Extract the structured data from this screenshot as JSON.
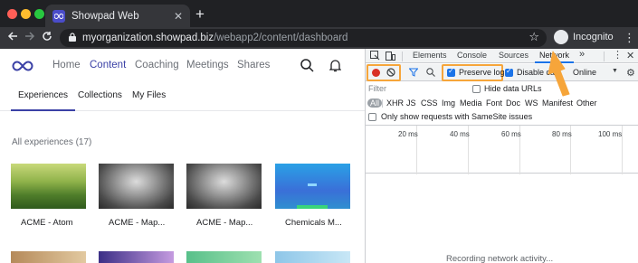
{
  "browser": {
    "tab_title": "Showpad Web",
    "tab_close": "✕",
    "new_tab": "+",
    "url_host": "myorganization.showpad.biz",
    "url_path": "/webapp2/content/dashboard",
    "incognito_label": "Incognito",
    "back_icon": "arrow-left-icon",
    "forward_icon": "arrow-right-icon",
    "reload_icon": "reload-icon"
  },
  "app": {
    "nav": [
      "Home",
      "Content",
      "Coaching",
      "Meetings",
      "Shares"
    ],
    "active_nav": "Content",
    "subtabs": [
      "Experiences",
      "Collections",
      "My Files"
    ],
    "active_subtab": "Experiences",
    "section_title": "All experiences (17)",
    "cards": [
      {
        "label": "ACME - Atom"
      },
      {
        "label": "ACME - Map..."
      },
      {
        "label": "ACME - Map..."
      },
      {
        "label": "Chemicals M..."
      }
    ],
    "accent_color": "#3b41a6"
  },
  "devtools": {
    "tabs": [
      "Elements",
      "Console",
      "Sources",
      "Network"
    ],
    "active_tab": "Network",
    "more": "»",
    "close": "✕",
    "preserve_log": {
      "label": "Preserve log",
      "checked": true
    },
    "disable_cache": {
      "label": "Disable cac",
      "checked": true
    },
    "throttle": "Online",
    "filter_placeholder": "Filter",
    "hide_data_urls": {
      "label": "Hide data URLs",
      "checked": false
    },
    "types": [
      "All",
      "XHR",
      "JS",
      "CSS",
      "Img",
      "Media",
      "Font",
      "Doc",
      "WS",
      "Manifest",
      "Other"
    ],
    "samesite": {
      "label": "Only show requests with SameSite issues",
      "checked": false
    },
    "ticks": [
      "20 ms",
      "40 ms",
      "60 ms",
      "80 ms",
      "100 ms"
    ],
    "recording": "Recording network activity...",
    "highlight_color": "#f6a53a"
  }
}
